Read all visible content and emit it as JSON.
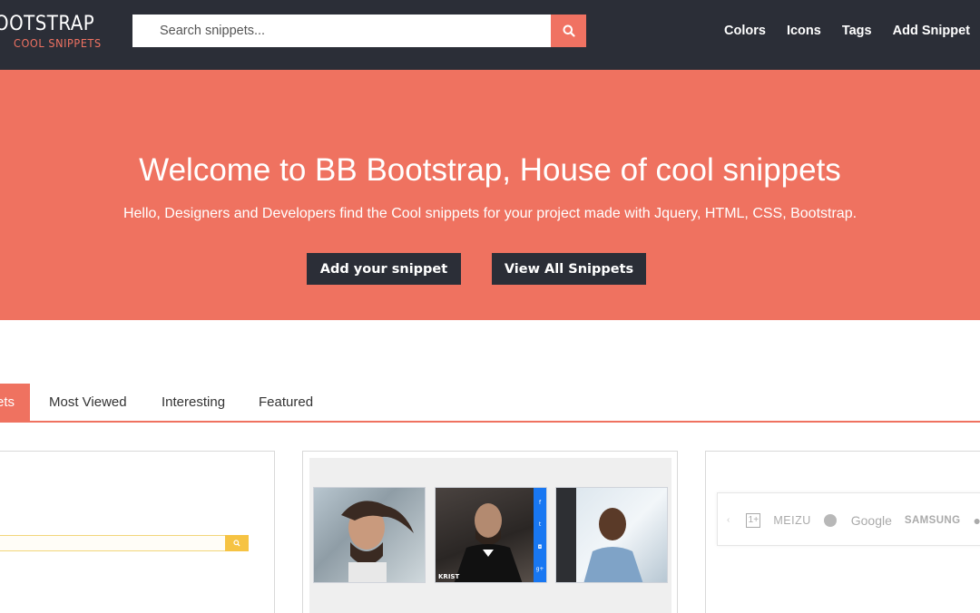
{
  "navbar": {
    "brand_top": "OOTSTRAP",
    "brand_bottom": "COOL SNIPPETS",
    "search_placeholder": "Search snippets...",
    "search_icon": "search-icon",
    "links": [
      "Colors",
      "Icons",
      "Tags",
      "Add Snippet"
    ]
  },
  "hero": {
    "title": "Welcome to BB Bootstrap, House of cool snippets",
    "subtitle": "Hello, Designers and Developers find the Cool snippets for your project made with Jquery, HTML, CSS, Bootstrap.",
    "add_button": "Add your snippet",
    "view_button": "View All Snippets"
  },
  "tabs": {
    "active": "ets",
    "items": [
      "Most Viewed",
      "Interesting",
      "Featured"
    ]
  },
  "cards": {
    "card2": {
      "social": [
        "f",
        "t",
        "◘",
        "g+"
      ],
      "caption": "KRIST"
    },
    "card3": {
      "logos": [
        "MEIZU",
        "Google",
        "SAMSUNG"
      ]
    }
  },
  "colors": {
    "navbar_bg": "#2b2e37",
    "accent": "#ef7260",
    "button_dark": "#2b2e37",
    "social_blue": "#1877f2"
  }
}
